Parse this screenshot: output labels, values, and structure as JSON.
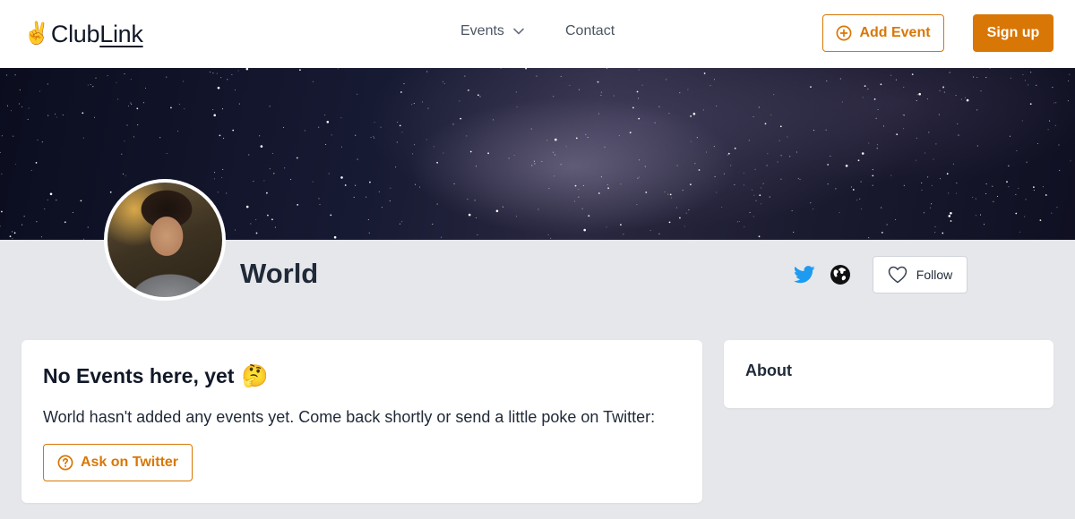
{
  "header": {
    "logo": {
      "emoji": "✌️",
      "club": "Club",
      "link": "Link"
    },
    "nav": {
      "events_label": "Events",
      "contact_label": "Contact"
    },
    "add_event_label": "Add Event",
    "signup_label": "Sign up"
  },
  "profile": {
    "name": "World",
    "follow_label": "Follow",
    "social_icons": [
      "twitter-icon",
      "globe-icon"
    ]
  },
  "events_card": {
    "title": "No Events here, yet",
    "title_emoji": "🤔",
    "message": "World hasn't added any events yet. Come back shortly or send a little poke on Twitter:",
    "ask_label": "Ask on Twitter"
  },
  "about_card": {
    "title": "About"
  },
  "colors": {
    "accent": "#d97706",
    "twitter": "#1d9bf0",
    "page_bg": "#e5e7eb",
    "text_dark": "#1f2937",
    "nav_text": "#4b5563"
  }
}
